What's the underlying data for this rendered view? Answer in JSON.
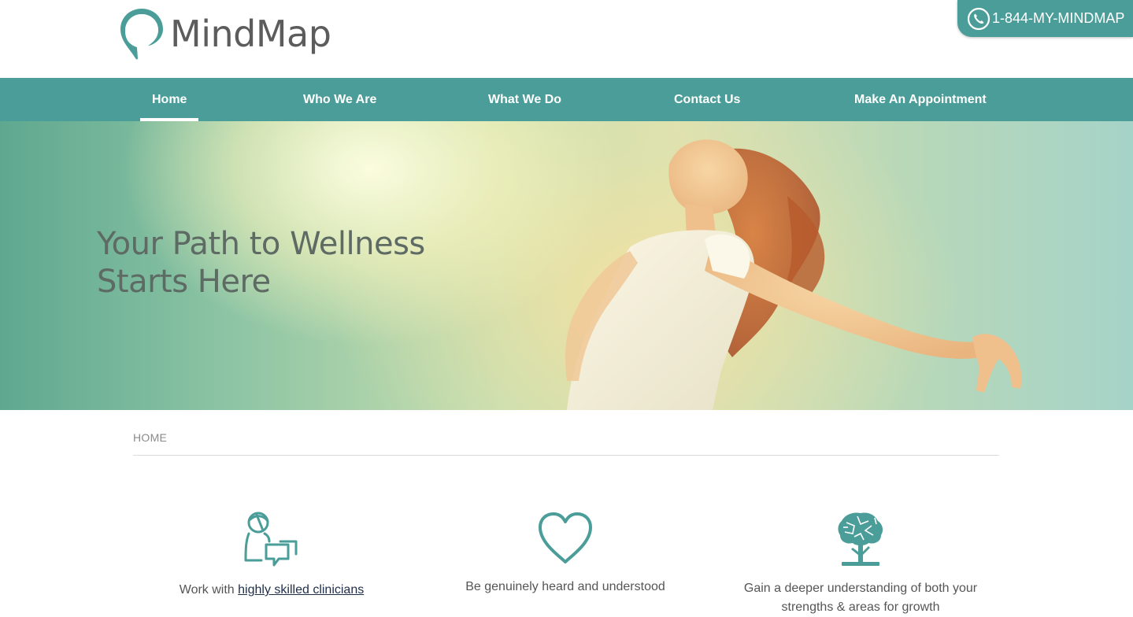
{
  "brand": {
    "name": "MindMap",
    "accent_color": "#4a9d98",
    "logo_icon": "speech-pin-icon"
  },
  "phone": {
    "number": "1-844-MY-MINDMAP",
    "icon": "phone-icon"
  },
  "nav": {
    "items": [
      {
        "label": "Home",
        "active": true
      },
      {
        "label": "Who We Are",
        "active": false
      },
      {
        "label": "What We Do",
        "active": false
      },
      {
        "label": "Contact Us",
        "active": false
      },
      {
        "label": "Make An Appointment",
        "active": false
      }
    ]
  },
  "hero": {
    "line1": "Your Path to Wellness",
    "line2": "Starts Here"
  },
  "breadcrumb": {
    "current": "HOME"
  },
  "features": [
    {
      "icon": "clinician-chat-icon",
      "prefix": "Work with ",
      "link": "highly skilled clinicians"
    },
    {
      "icon": "heart-icon",
      "text": "Be genuinely heard and understood"
    },
    {
      "icon": "brain-tree-icon",
      "text": "Gain a deeper understanding of both your strengths & areas for growth"
    }
  ]
}
